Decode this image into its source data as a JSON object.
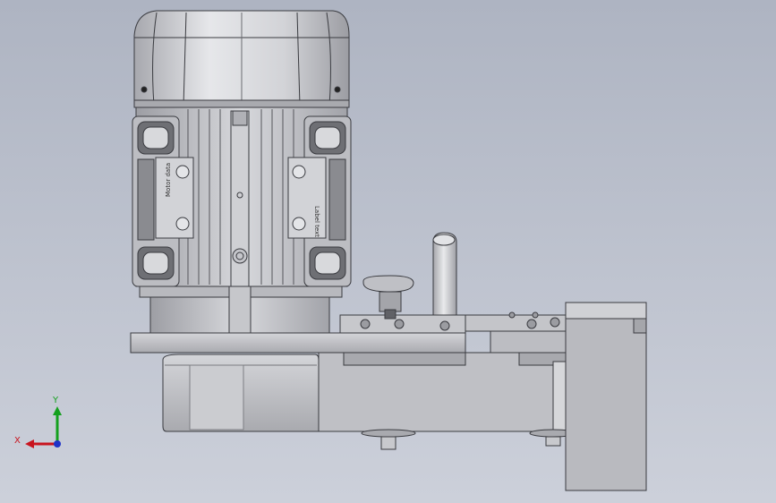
{
  "viewport": {
    "background_top": "#aeb4c2",
    "background_bottom": "#ccd0da"
  },
  "model": {
    "terminal_plate_texts": [
      "Motor data",
      "Label text"
    ],
    "colors": {
      "body": "#c8c9ce",
      "body_dark": "#8f9096",
      "edge": "#3a3b40",
      "steel": "#b5b6bb"
    }
  },
  "triad": {
    "x_label": "X",
    "y_label": "Y",
    "x_color": "#c8141e",
    "y_color": "#14a01e",
    "z_color": "#1e32c8"
  }
}
